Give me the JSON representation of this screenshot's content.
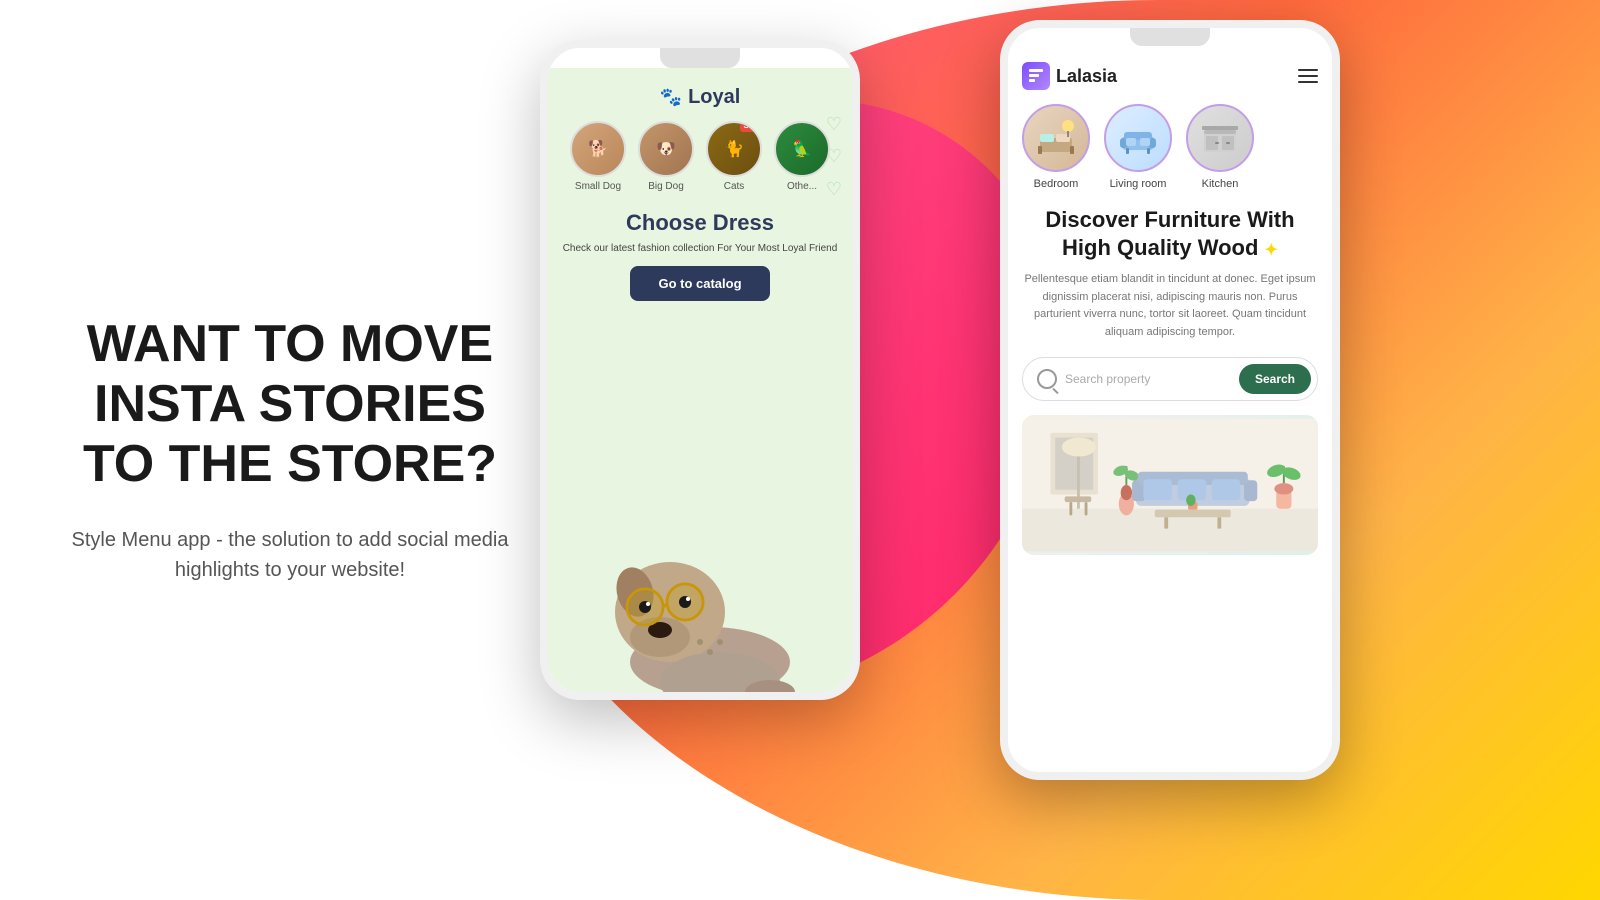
{
  "page": {
    "background_gradient": "linear-gradient(135deg, #ff4e8b, #ff6a3d, #ffb347)",
    "left_panel": {
      "headline": "WANT TO MOVE INSTA STORIES TO THE STORE?",
      "subtext": "Style Menu app - the solution to add social media highlights to your website!"
    },
    "phone1": {
      "app_name": "Loyal",
      "categories": [
        {
          "label": "Small Dog",
          "type": "dog1"
        },
        {
          "label": "Big Dog",
          "type": "dog2"
        },
        {
          "label": "Cats",
          "type": "cat",
          "badge": "Sale"
        },
        {
          "label": "Othe...",
          "type": "other"
        }
      ],
      "section_title": "Choose Dress",
      "section_desc": "Check our latest fashion collection For Your Most Loyal Friend",
      "cta_button": "Go to catalog"
    },
    "phone2": {
      "app_name": "Lalasia",
      "categories": [
        {
          "label": "Bedroom",
          "type": "bedroom"
        },
        {
          "label": "Living room",
          "type": "living"
        },
        {
          "label": "Kitchen",
          "type": "kitchen"
        }
      ],
      "headline": "Discover Furniture With High Quality Wood",
      "description": "Pellentesque etiam blandit in tincidunt at donec. Eget ipsum dignissim placerat nisi, adipiscing mauris non. Purus parturient viverra nunc, tortor sit laoreet. Quam tincidunt aliquam adipiscing tempor.",
      "search_placeholder": "Search property",
      "search_button": "Search"
    }
  }
}
